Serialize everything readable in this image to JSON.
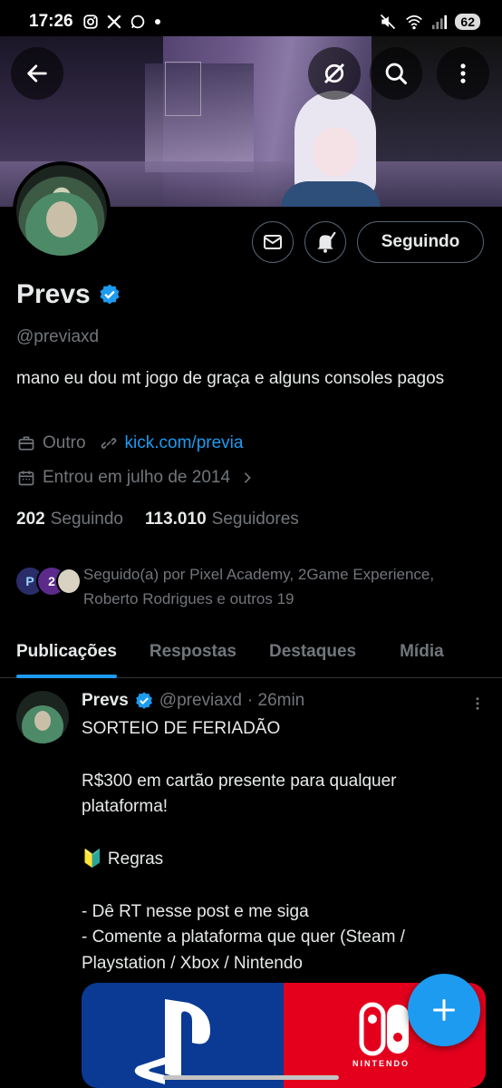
{
  "status_bar": {
    "time": "17:26",
    "left_icons": [
      "instagram-icon",
      "x-icon",
      "whatsapp-icon",
      "dot"
    ],
    "right_icons": [
      "mute-icon",
      "wifi-icon",
      "signal-icon"
    ],
    "battery": "62"
  },
  "header": {
    "back": "back-arrow-icon",
    "grok": "grok-icon",
    "search": "search-icon",
    "more": "more-vertical-icon"
  },
  "profile": {
    "name": "Prevs",
    "handle": "@previaxd",
    "bio": "mano eu dou mt jogo de graça e alguns consoles pagos",
    "category": "Outro",
    "link": "kick.com/previa",
    "joined": "Entrou em julho de 2014",
    "following_count": "202",
    "following_label": "Seguindo",
    "followers_count": "113.010",
    "followers_label": "Seguidores",
    "followed_by": "Seguido(a) por Pixel Academy, 2Game Experience, Roberto Rodrigues e outros 19",
    "follow_button": "Seguindo"
  },
  "tabs": [
    {
      "label": "Publicações",
      "active": true
    },
    {
      "label": "Respostas",
      "active": false
    },
    {
      "label": "Destaques",
      "active": false
    },
    {
      "label": "Mídia",
      "active": false
    }
  ],
  "post": {
    "name": "Prevs",
    "handle": "@previaxd",
    "time": "· 26min",
    "text": "SORTEIO DE FERIADÃO\n\nR$300 em cartão presente para qualquer plataforma!\n\n🔰 Regras\n\n- Dê RT nesse post e me siga\n- Comente a plataforma que quer (Steam / Playstation / Xbox / Nintendo",
    "media_caption": "NINTENDO"
  },
  "colors": {
    "accent": "#1d9bf0",
    "background": "#000000",
    "secondary_text": "#71767b"
  }
}
